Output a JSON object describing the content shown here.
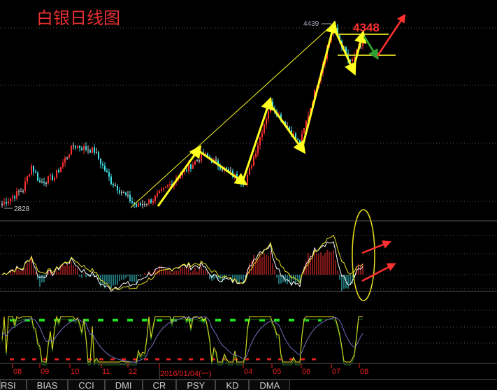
{
  "title": "白银日线图",
  "chart_data": {
    "type": "candlestick",
    "title": "白银日线图",
    "price_range": [
      2828,
      4439
    ],
    "labels": {
      "high": "4439",
      "low": "2828",
      "current": "4348"
    },
    "keypoints": [
      [
        0,
        2860
      ],
      [
        10,
        2990
      ],
      [
        14,
        3200
      ],
      [
        18,
        3050
      ],
      [
        25,
        3100
      ],
      [
        34,
        3380
      ],
      [
        44,
        3330
      ],
      [
        52,
        3060
      ],
      [
        64,
        2840
      ],
      [
        72,
        2900
      ],
      [
        96,
        3300
      ],
      [
        116,
        3040
      ],
      [
        128,
        3750
      ],
      [
        142,
        3390
      ],
      [
        158,
        4439
      ],
      [
        166,
        4100
      ],
      [
        172,
        4300
      ]
    ],
    "x_ticks": [
      "08",
      "09",
      "10",
      "11",
      "12",
      "2016/01/04(一)",
      "04",
      "05",
      "06",
      "07",
      "08"
    ],
    "indicators": [
      "MACD",
      "KD"
    ]
  },
  "tabs": [
    "RSI",
    "BIAS",
    "CCI",
    "DMI",
    "CR",
    "PSY",
    "KD",
    "DMA"
  ],
  "colors": {
    "up": "#ff3030",
    "down": "#40e0e8",
    "flat": "#d0d0d0",
    "annot": "#ffff20",
    "arrow": "#ff3030"
  }
}
